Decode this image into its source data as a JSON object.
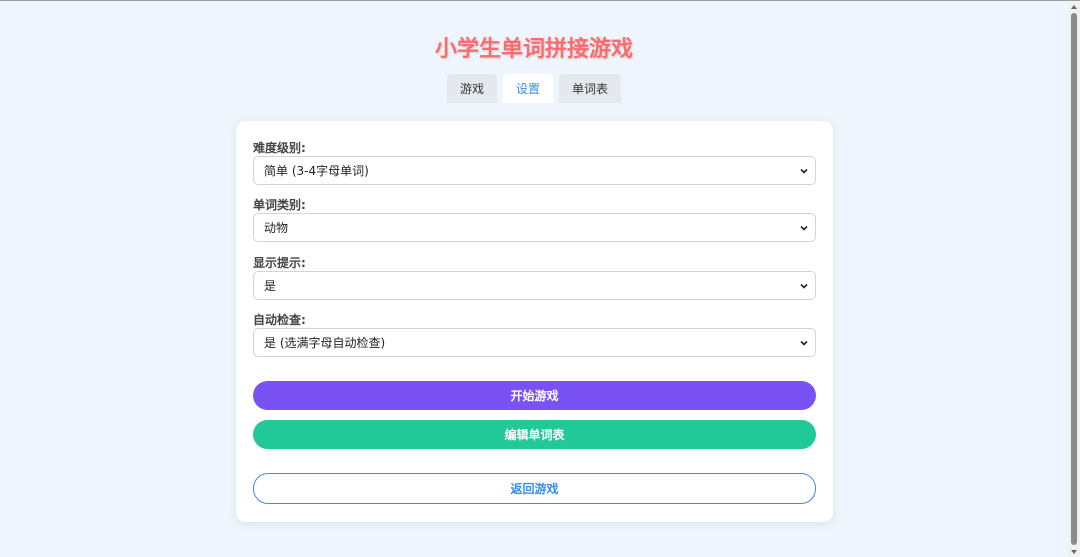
{
  "app": {
    "title": "小学生单词拼接游戏"
  },
  "tabs": [
    {
      "label": "游戏",
      "active": false
    },
    {
      "label": "设置",
      "active": true
    },
    {
      "label": "单词表",
      "active": false
    }
  ],
  "settings": {
    "difficulty": {
      "label": "难度级别:",
      "value": "简单 (3-4字母单词)"
    },
    "category": {
      "label": "单词类别:",
      "value": "动物"
    },
    "hints": {
      "label": "显示提示:",
      "value": "是"
    },
    "auto_check": {
      "label": "自动检查:",
      "value": "是 (选满字母自动检查)"
    }
  },
  "buttons": {
    "start": "开始游戏",
    "edit": "编辑单词表",
    "back": "返回游戏"
  },
  "colors": {
    "title": "#ff6b6b",
    "tab_active": "#3a8ee6",
    "start_button": "#7a52f3",
    "edit_button": "#20c997",
    "back_button_border": "#3a8ee6",
    "background": "#eef5fd"
  },
  "icons": {
    "select_arrow": "chevron-down-icon"
  }
}
